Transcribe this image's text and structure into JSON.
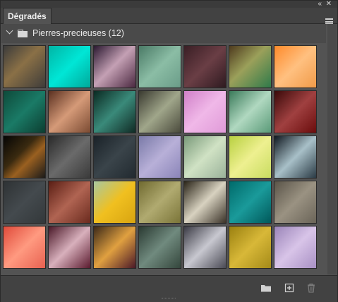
{
  "panel": {
    "tab_label": "Dégradés",
    "collapse_glyph": "«",
    "close_glyph": "✕"
  },
  "group": {
    "label": "Pierres-precieuses (12)",
    "expanded": true
  },
  "swatches": [
    "linear-gradient(135deg,#3b3b3b 0%,#8a7046 45%,#3e3c3a 100%)",
    "linear-gradient(135deg,#00b5a5 0%,#00e6d6 50%,#00a89a 100%)",
    "linear-gradient(135deg,#2a1830 0%,#c4a0b4 48%,#4a2840 100%)",
    "linear-gradient(135deg,#4a7a66 0%,#8bbda5 50%,#6a9c88 100%)",
    "linear-gradient(135deg,#3a1f25 0%,#6a3e45 50%,#2e1a20 100%)",
    "linear-gradient(135deg,#4e3a1e 0%,#9ba05a 45%,#2f7a4a 100%)",
    "linear-gradient(135deg,#ff8a2a 0%,#ffc080 50%,#f09a48 100%)",
    "linear-gradient(135deg,#0e4a3a 0%,#1a7a66 50%,#0c3d30 100%)",
    "linear-gradient(135deg,#5a3020 0%,#d59a78 50%,#7a4a32 100%)",
    "linear-gradient(135deg,#0a2a22 0%,#3a8a7a 50%,#102a24 100%)",
    "linear-gradient(135deg,#3a3a30 0%,#a0a68a 50%,#4a4a3c 100%)",
    "linear-gradient(135deg,#d080c8 0%,#f0b8e8 50%,#e09ad8 100%)",
    "linear-gradient(135deg,#3a7a5a 0%,#b0d8c0 50%,#5a9a78 100%)",
    "linear-gradient(135deg,#3a0a0a 0%,#a04040 50%,#6a0c0c 100%)",
    "linear-gradient(135deg,#050505 0%,#3a2a10 40%,#9a6020 60%,#1a1a1a 100%)",
    "linear-gradient(135deg,#2a2a2a 0%,#6a6a6a 50%,#3a3a3a 100%)",
    "linear-gradient(135deg,#1a2228 0%,#3a444a 50%,#222a30 100%)",
    "linear-gradient(135deg,#7a7aa8 0%,#b8b0d8 50%,#8a84b8 100%)",
    "linear-gradient(135deg,#7a9a7a 0%,#d0e2c4 50%,#9ab29a 100%)",
    "linear-gradient(135deg,#b8d040 0%,#eef090 50%,#c8dc60 100%)",
    "linear-gradient(135deg,#101820 0%,#a8c0c8 50%,#2a3a44 100%)",
    "linear-gradient(135deg,#2e3234 0%,#444a4e 50%,#33383a 100%)",
    "linear-gradient(135deg,#5a1e14 0%,#b06452 50%,#6a2a1e 100%)",
    "linear-gradient(135deg,#a8c8a0 0%,#f0c020 50%,#d8a410 100%)",
    "linear-gradient(135deg,#706a30 0%,#b0aa70 50%,#7a7438 100%)",
    "linear-gradient(135deg,#2a2418 0%,#d8d2c0 50%,#3a3228 100%)",
    "linear-gradient(135deg,#006a6a 0%,#1a9a9a 50%,#00585a 100%)",
    "linear-gradient(135deg,#5a5448 0%,#9a9282 50%,#6a6458 100%)",
    "linear-gradient(135deg,#e04a3a 0%,#ff9a80 50%,#e86050 100%)",
    "linear-gradient(135deg,#4a1828 0%,#d8b0bc 50%,#5a1a2e 100%)",
    "linear-gradient(135deg,#3a2818 0%,#e0a040 50%,#4a1828 100%)",
    "linear-gradient(135deg,#2a3a32 0%,#708a7e 50%,#34463c 100%)",
    "linear-gradient(135deg,#3a3a44 0%,#c8c8d0 50%,#4a4a54 100%)",
    "linear-gradient(135deg,#9a8010 0%,#d8b838 50%,#a48a18 100%)",
    "linear-gradient(135deg,#9a84b8 0%,#d8c4e8 50%,#a890c4 100%)"
  ],
  "footer": {
    "new_group_icon": "folder-icon",
    "new_gradient_icon": "plus-square-icon",
    "delete_icon": "trash-icon"
  }
}
